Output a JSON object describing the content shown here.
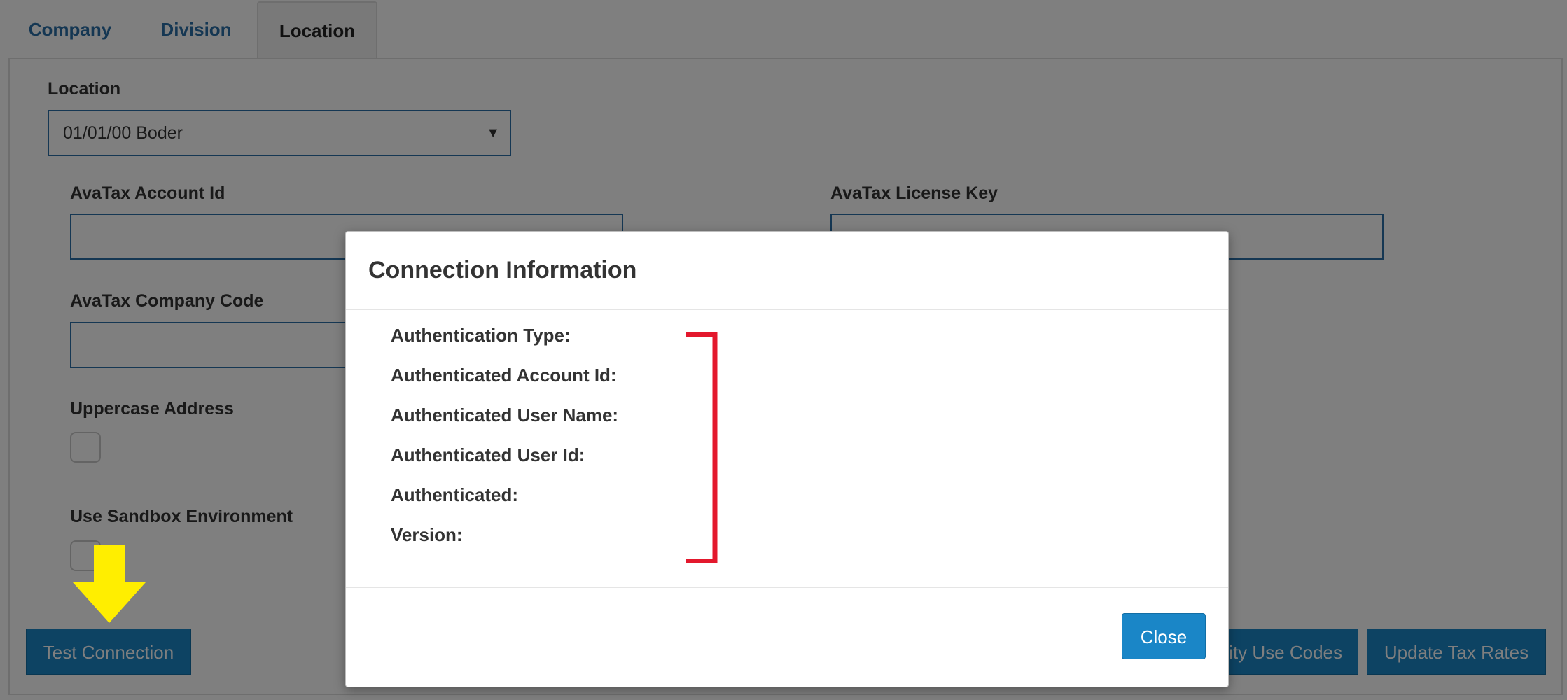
{
  "tabs": [
    {
      "label": "Company"
    },
    {
      "label": "Division"
    },
    {
      "label": "Location"
    }
  ],
  "form": {
    "location_label": "Location",
    "location_value": "01/01/00 Boder",
    "account_id_label": "AvaTax Account Id",
    "license_key_label": "AvaTax License Key",
    "company_code_label": "AvaTax Company Code",
    "uppercase_label": "Uppercase Address",
    "sandbox_label": "Use Sandbox Environment"
  },
  "buttons": {
    "test_connection": "Test Connection",
    "entity_use_codes": "tity Use Codes",
    "update_tax_rates": "Update Tax Rates"
  },
  "modal": {
    "title": "Connection Information",
    "fields": [
      "Authentication Type:",
      "Authenticated Account Id:",
      "Authenticated User Name:",
      "Authenticated User Id:",
      "Authenticated:",
      "Version:"
    ],
    "close_label": "Close"
  },
  "colors": {
    "accent": "#1a86c7",
    "annotation_red": "#e3182d",
    "annotation_yellow": "#ffee00"
  },
  "icons": {
    "dropdown": "caret-down-icon",
    "arrow": "down-arrow-icon",
    "bracket": "bracket-icon"
  }
}
